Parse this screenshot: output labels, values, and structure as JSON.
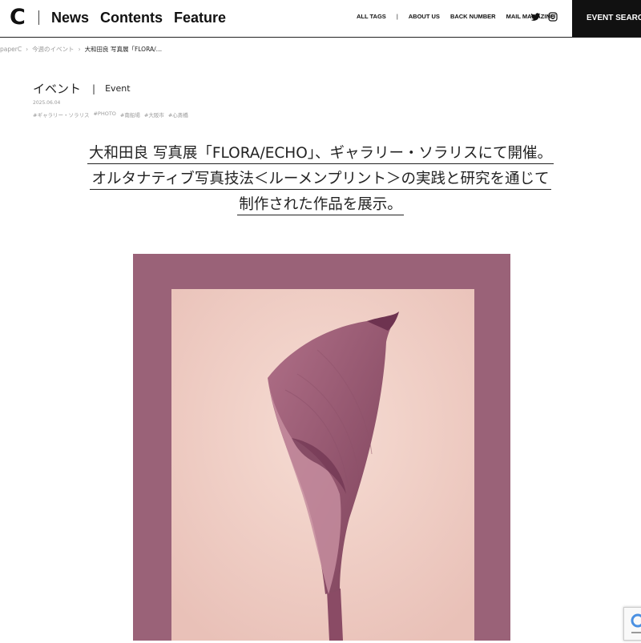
{
  "header": {
    "logo_text": "C",
    "main_nav": [
      "News",
      "Contents",
      "Feature"
    ],
    "sub_nav": {
      "all_tags": "ALL TAGS",
      "separator": "|",
      "about_us": "ABOUT US",
      "back_number": "BACK NUMBER",
      "mail_magazine": "MAIL MAGAZINE"
    },
    "social_icons": [
      "twitter-icon",
      "instagram-icon"
    ],
    "event_search": "EVENT SEARCH"
  },
  "breadcrumb": {
    "items": [
      "paperC",
      "今週のイベント",
      "大和田良 写真展「FLORA/…"
    ]
  },
  "article": {
    "category_ja": "イベント",
    "category_en": "Event",
    "date": "2025.06.04",
    "tags": [
      "#ギャラリー・ソラリス",
      "#PHOTO",
      "#南船場",
      "#大阪市",
      "#心斎橋"
    ],
    "title_lines": [
      "大和田良 写真展「FLORA/ECHO」、ギャラリー・ソラリスにて開催。",
      "オルタナティブ写真技法＜ルーメンプリント＞の実践と研究を通じて",
      "制作された作品を展示。"
    ]
  },
  "image": {
    "subject": "calla-lily-lumen-print"
  },
  "colors": {
    "header_border": "#222222",
    "search_bg": "#111111",
    "photo_frame": "#9a6278",
    "photo_inner": "#f1d2c9"
  }
}
